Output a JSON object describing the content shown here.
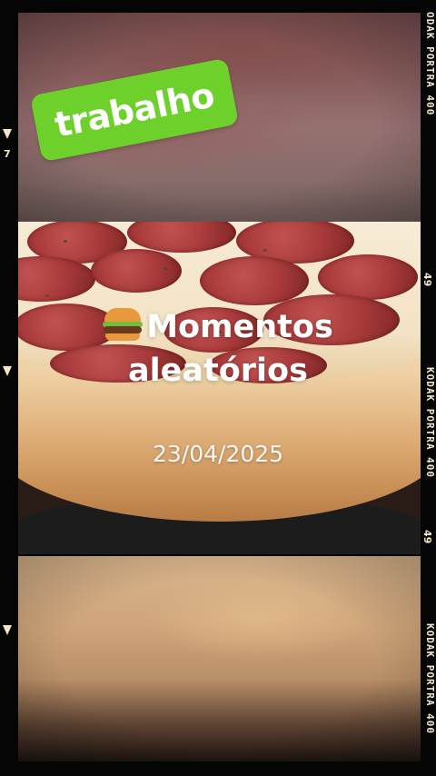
{
  "story": {
    "sticker_text": "trabalho",
    "title_line1": "Momentos",
    "title_line2": "aleatórios",
    "emoji_icon": "hamburger-icon",
    "date": "23/04/2025"
  },
  "film": {
    "brand_text": "KODAK PORTRA 400",
    "brand_text_top": "ODAK PORTRA 400",
    "frame_number": "49",
    "frame_number_left": "7"
  },
  "colors": {
    "sticker": "#6ed12b",
    "film_text": "#f2e6c8",
    "film_background": "#050505"
  }
}
